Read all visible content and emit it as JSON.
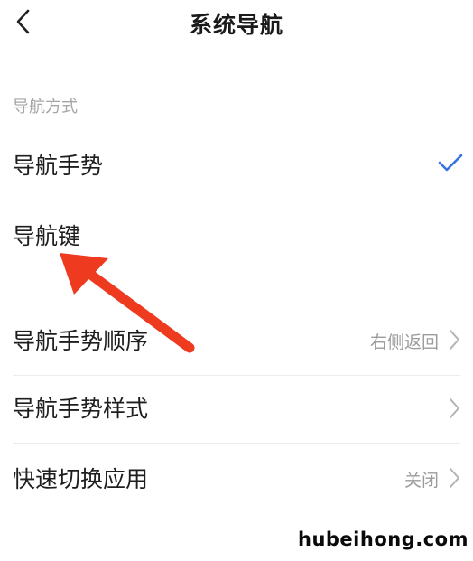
{
  "header": {
    "title": "系统导航"
  },
  "section": {
    "label": "导航方式"
  },
  "options": [
    {
      "label": "导航手势",
      "selected": true
    },
    {
      "label": "导航键",
      "selected": false
    }
  ],
  "settings": [
    {
      "label": "导航手势顺序",
      "value": "右侧返回"
    },
    {
      "label": "导航手势样式",
      "value": ""
    },
    {
      "label": "快速切换应用",
      "value": "关闭"
    }
  ],
  "colors": {
    "accent": "#3a74e0",
    "annotation_arrow": "#ee3a1f"
  },
  "watermark": "hubeihong.com"
}
